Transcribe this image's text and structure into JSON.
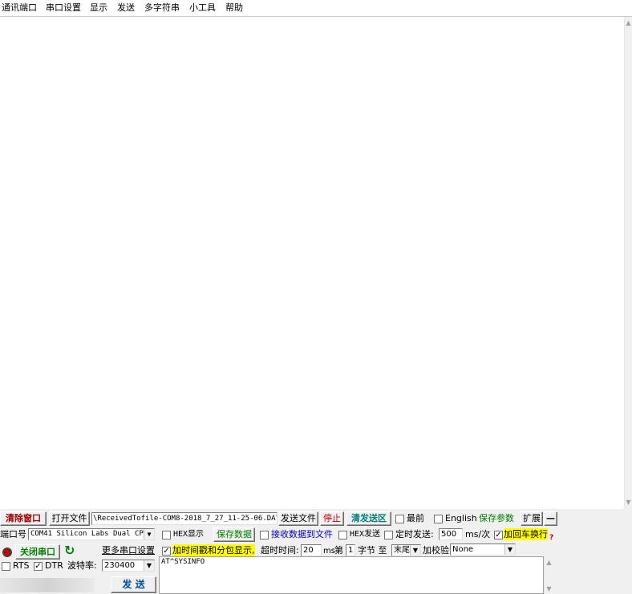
{
  "menu": [
    "通讯端口",
    "串口设置",
    "显示",
    "发送",
    "多字符串",
    "小工具",
    "帮助"
  ],
  "toolbar": {
    "clear_window": "清除窗口",
    "open_file": "打开文件",
    "file_path": "\\ReceivedTofile-COM8-2018_7_27_11-25-06.DAT",
    "send_file": "发送文件",
    "stop": "停止",
    "clear_send": "清发送区",
    "topmost": "最前",
    "english": "English",
    "save_params": "保存参数",
    "expand": "扩展",
    "collapse": "—"
  },
  "port": {
    "label": "端口号",
    "value": "COM41 Silicon Labs Dual CP",
    "close_button": "关闭串口",
    "more_settings": "更多串口设置",
    "rts": "RTS",
    "dtr": "DTR",
    "baud_label": "波特率:",
    "baud_value": "230400"
  },
  "options": {
    "hex_display": "HEX显示",
    "save_data": "保存数据",
    "recv_to_file": "接收数据到文件",
    "timestamp": "加时间戳和分包显示,",
    "timeout_label": "超时时间:",
    "timeout_value": "20",
    "ms": "ms",
    "nth_label": "第",
    "nth_value": "1",
    "byte_to": "字节 至",
    "tail": "末尾",
    "checksum_label": "加校验",
    "checksum_value": "None",
    "hex_send": "HEX发送",
    "timed_send": "定时发送:",
    "interval_value": "500",
    "interval_unit": "ms/次",
    "crlf": "加回车换行"
  },
  "send": {
    "text": "AT^SYSINFO",
    "button": "发 送"
  },
  "checks": {
    "dtr": true,
    "timestamp": true,
    "crlf": true,
    "rts": false,
    "hex_display": false,
    "recv_to_file": false,
    "hex_send": false,
    "timed_send": false,
    "topmost": false,
    "english": false
  }
}
